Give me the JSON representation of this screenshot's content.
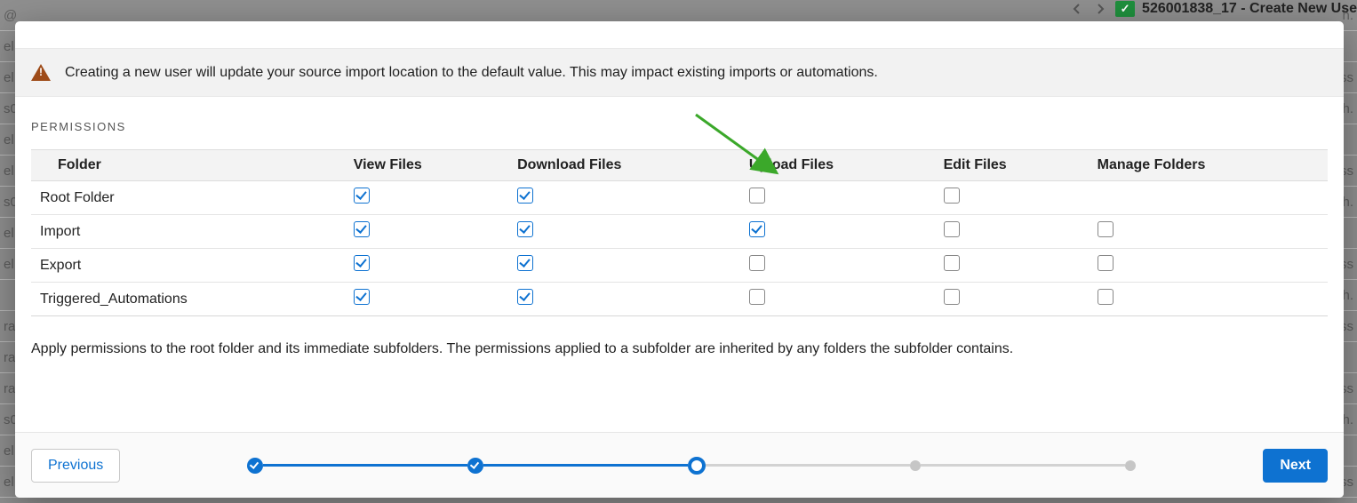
{
  "background": {
    "top_right_title": "526001838_17 - Create New Use"
  },
  "warning": {
    "text": "Creating a new user will update your source import location to the default value. This may impact existing imports or automations."
  },
  "permissions": {
    "section_label": "PERMISSIONS",
    "columns": [
      "Folder",
      "View Files",
      "Download Files",
      "Upload Files",
      "Edit Files",
      "Manage Folders"
    ],
    "rows": [
      {
        "name": "Root Folder",
        "indent": 0,
        "view": true,
        "download": true,
        "upload": false,
        "edit": false,
        "manage": null
      },
      {
        "name": "Import",
        "indent": 1,
        "view": true,
        "download": true,
        "upload": true,
        "edit": false,
        "manage": false
      },
      {
        "name": "Export",
        "indent": 1,
        "view": true,
        "download": true,
        "upload": false,
        "edit": false,
        "manage": false
      },
      {
        "name": "Triggered_Automations",
        "indent": 1,
        "view": true,
        "download": true,
        "upload": false,
        "edit": false,
        "manage": false
      }
    ],
    "helper_text": "Apply permissions to the root folder and its immediate subfolders. The permissions applied to a subfolder are inherited by any folders the subfolder contains."
  },
  "footer": {
    "previous_label": "Previous",
    "next_label": "Next",
    "steps": [
      "done",
      "done",
      "active",
      "future",
      "future"
    ]
  }
}
